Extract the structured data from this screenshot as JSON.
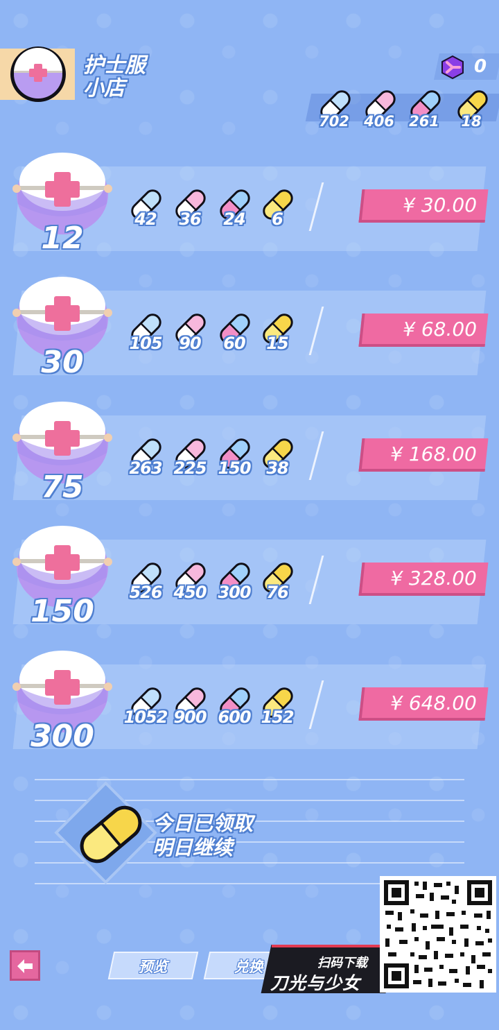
{
  "header": {
    "title_line1": "护士服",
    "title_line2": "小店",
    "currency_count": "0"
  },
  "totals": [
    "702",
    "406",
    "261",
    "18"
  ],
  "pill_colors": {
    "blue": "#bfe0fb",
    "pink": "#f7b8dc",
    "pinkblue": "#f38fc6",
    "gold": "#f7d64a"
  },
  "packages": [
    {
      "qty": "12",
      "pills": [
        "42",
        "36",
        "24",
        "6"
      ],
      "price": "¥ 30.00"
    },
    {
      "qty": "30",
      "pills": [
        "105",
        "90",
        "60",
        "15"
      ],
      "price": "¥ 68.00"
    },
    {
      "qty": "75",
      "pills": [
        "263",
        "225",
        "150",
        "38"
      ],
      "price": "¥ 168.00"
    },
    {
      "qty": "150",
      "pills": [
        "526",
        "450",
        "300",
        "76"
      ],
      "price": "¥ 328.00"
    },
    {
      "qty": "300",
      "pills": [
        "1052",
        "900",
        "600",
        "152"
      ],
      "price": "¥ 648.00"
    }
  ],
  "daily": {
    "line1": "今日已领取",
    "line2": "明日继续"
  },
  "bottom": {
    "preview_label": "预览",
    "exchange_label": "兑换"
  },
  "promo": {
    "scan_label": "扫码下载",
    "game_name": "刀光与少女"
  },
  "icons": {
    "back": "back-arrow-icon",
    "currency": "currency-gem-icon",
    "pill": "capsule-icon",
    "hat": "nurse-hat-icon",
    "qr": "qr-code"
  }
}
